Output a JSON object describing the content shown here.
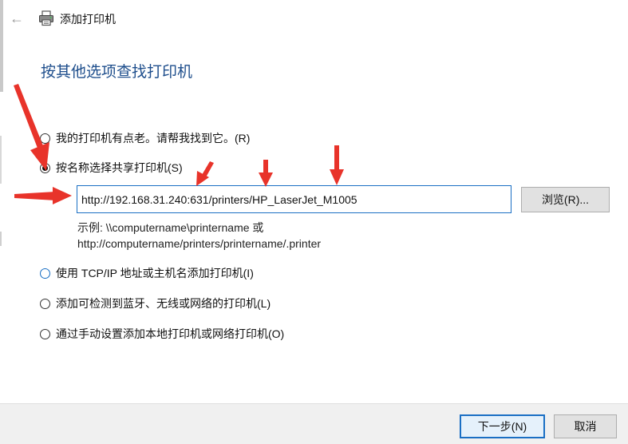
{
  "window": {
    "title": "添加打印机",
    "back_glyph": "←",
    "printer_icon": "printer-icon"
  },
  "heading": "按其他选项查找打印机",
  "options": [
    {
      "label": "我的打印机有点老。请帮我找到它。(R)",
      "checked": false
    },
    {
      "label": "按名称选择共享打印机(S)",
      "checked": true
    },
    {
      "label": "使用 TCP/IP 地址或主机名添加打印机(I)",
      "checked": false
    },
    {
      "label": "添加可检测到蓝牙、无线或网络的打印机(L)",
      "checked": false
    },
    {
      "label": "通过手动设置添加本地打印机或网络打印机(O)",
      "checked": false
    }
  ],
  "share_name": {
    "value": "http://192.168.31.240:631/printers/HP_LaserJet_M1005",
    "browse_label": "浏览(R)..."
  },
  "example": {
    "line1": "示例: \\\\computername\\printername 或",
    "line2": "http://computername/printers/printername/.printer"
  },
  "footer": {
    "next_label": "下一步(N)",
    "cancel_label": "取消"
  },
  "colors": {
    "heading": "#1e4e8c",
    "accent": "#1a6fc4",
    "annotation": "#e8332a"
  }
}
